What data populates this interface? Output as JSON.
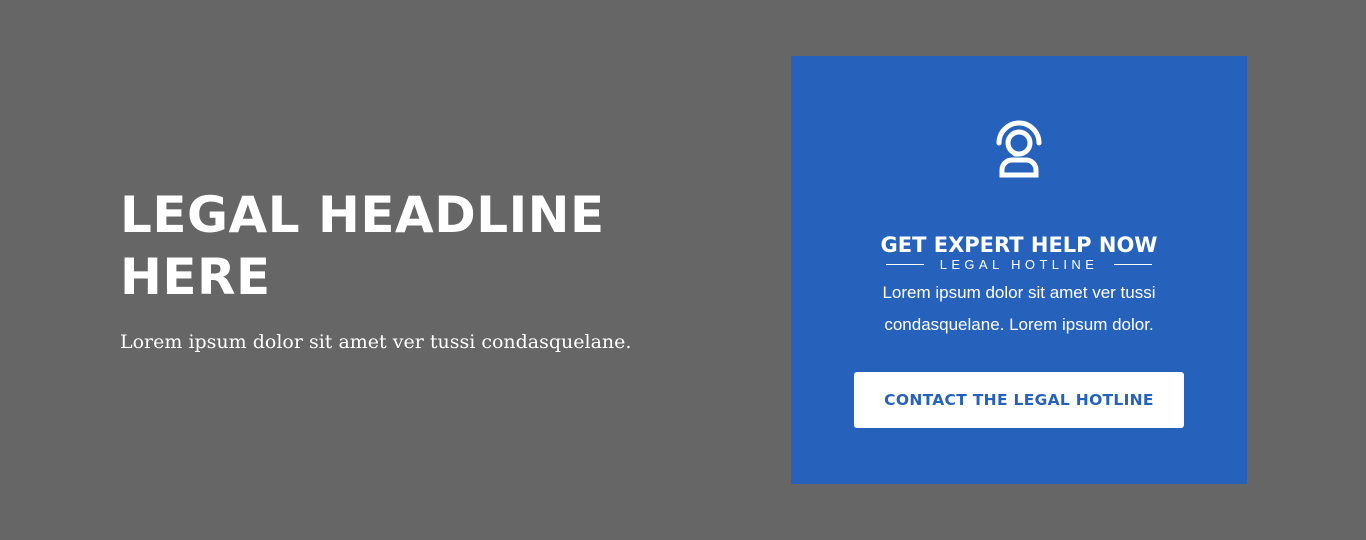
{
  "hero": {
    "headline": "LEGAL HEADLINE HERE",
    "lead": "Lorem ipsum dolor sit amet ver tussi condasquelane."
  },
  "card": {
    "icon": "headset-icon",
    "eyebrow": "LEGAL HOTLINE",
    "title": "GET EXPERT HELP NOW",
    "body": "Lorem ipsum dolor sit amet ver tussi condasquelane. Lorem ipsum dolor.",
    "cta_label": "CONTACT THE LEGAL HOTLINE"
  },
  "colors": {
    "page_background": "#666666",
    "card_background": "#2662bc",
    "text": "#ffffff",
    "cta_text": "#2662bc"
  }
}
